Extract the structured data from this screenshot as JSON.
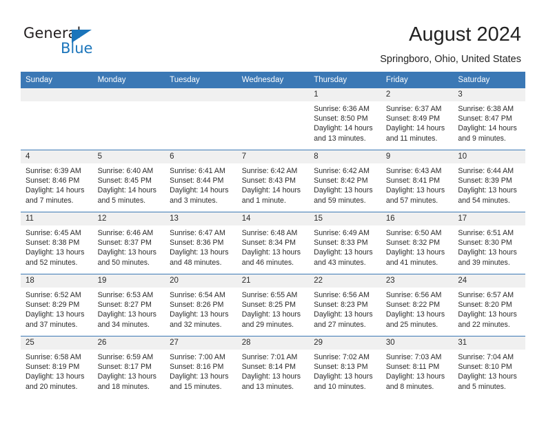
{
  "brand": {
    "name_part1": "General",
    "name_part2": "Blue",
    "accent_color": "#1b75bb"
  },
  "header": {
    "title": "August 2024",
    "location": "Springboro, Ohio, United States"
  },
  "calendar": {
    "header_bg": "#3b78b5",
    "daynum_bg": "#f0f0f0",
    "weekdays": [
      "Sunday",
      "Monday",
      "Tuesday",
      "Wednesday",
      "Thursday",
      "Friday",
      "Saturday"
    ],
    "weeks": [
      [
        {
          "day": "",
          "blank": true,
          "sunrise": "",
          "sunset": "",
          "daylight_line1": "",
          "daylight_line2": ""
        },
        {
          "day": "",
          "blank": true,
          "sunrise": "",
          "sunset": "",
          "daylight_line1": "",
          "daylight_line2": ""
        },
        {
          "day": "",
          "blank": true,
          "sunrise": "",
          "sunset": "",
          "daylight_line1": "",
          "daylight_line2": ""
        },
        {
          "day": "",
          "blank": true,
          "sunrise": "",
          "sunset": "",
          "daylight_line1": "",
          "daylight_line2": ""
        },
        {
          "day": "1",
          "blank": false,
          "sunrise": "Sunrise: 6:36 AM",
          "sunset": "Sunset: 8:50 PM",
          "daylight_line1": "Daylight: 14 hours",
          "daylight_line2": "and 13 minutes."
        },
        {
          "day": "2",
          "blank": false,
          "sunrise": "Sunrise: 6:37 AM",
          "sunset": "Sunset: 8:49 PM",
          "daylight_line1": "Daylight: 14 hours",
          "daylight_line2": "and 11 minutes."
        },
        {
          "day": "3",
          "blank": false,
          "sunrise": "Sunrise: 6:38 AM",
          "sunset": "Sunset: 8:47 PM",
          "daylight_line1": "Daylight: 14 hours",
          "daylight_line2": "and 9 minutes."
        }
      ],
      [
        {
          "day": "4",
          "blank": false,
          "sunrise": "Sunrise: 6:39 AM",
          "sunset": "Sunset: 8:46 PM",
          "daylight_line1": "Daylight: 14 hours",
          "daylight_line2": "and 7 minutes."
        },
        {
          "day": "5",
          "blank": false,
          "sunrise": "Sunrise: 6:40 AM",
          "sunset": "Sunset: 8:45 PM",
          "daylight_line1": "Daylight: 14 hours",
          "daylight_line2": "and 5 minutes."
        },
        {
          "day": "6",
          "blank": false,
          "sunrise": "Sunrise: 6:41 AM",
          "sunset": "Sunset: 8:44 PM",
          "daylight_line1": "Daylight: 14 hours",
          "daylight_line2": "and 3 minutes."
        },
        {
          "day": "7",
          "blank": false,
          "sunrise": "Sunrise: 6:42 AM",
          "sunset": "Sunset: 8:43 PM",
          "daylight_line1": "Daylight: 14 hours",
          "daylight_line2": "and 1 minute."
        },
        {
          "day": "8",
          "blank": false,
          "sunrise": "Sunrise: 6:42 AM",
          "sunset": "Sunset: 8:42 PM",
          "daylight_line1": "Daylight: 13 hours",
          "daylight_line2": "and 59 minutes."
        },
        {
          "day": "9",
          "blank": false,
          "sunrise": "Sunrise: 6:43 AM",
          "sunset": "Sunset: 8:41 PM",
          "daylight_line1": "Daylight: 13 hours",
          "daylight_line2": "and 57 minutes."
        },
        {
          "day": "10",
          "blank": false,
          "sunrise": "Sunrise: 6:44 AM",
          "sunset": "Sunset: 8:39 PM",
          "daylight_line1": "Daylight: 13 hours",
          "daylight_line2": "and 54 minutes."
        }
      ],
      [
        {
          "day": "11",
          "blank": false,
          "sunrise": "Sunrise: 6:45 AM",
          "sunset": "Sunset: 8:38 PM",
          "daylight_line1": "Daylight: 13 hours",
          "daylight_line2": "and 52 minutes."
        },
        {
          "day": "12",
          "blank": false,
          "sunrise": "Sunrise: 6:46 AM",
          "sunset": "Sunset: 8:37 PM",
          "daylight_line1": "Daylight: 13 hours",
          "daylight_line2": "and 50 minutes."
        },
        {
          "day": "13",
          "blank": false,
          "sunrise": "Sunrise: 6:47 AM",
          "sunset": "Sunset: 8:36 PM",
          "daylight_line1": "Daylight: 13 hours",
          "daylight_line2": "and 48 minutes."
        },
        {
          "day": "14",
          "blank": false,
          "sunrise": "Sunrise: 6:48 AM",
          "sunset": "Sunset: 8:34 PM",
          "daylight_line1": "Daylight: 13 hours",
          "daylight_line2": "and 46 minutes."
        },
        {
          "day": "15",
          "blank": false,
          "sunrise": "Sunrise: 6:49 AM",
          "sunset": "Sunset: 8:33 PM",
          "daylight_line1": "Daylight: 13 hours",
          "daylight_line2": "and 43 minutes."
        },
        {
          "day": "16",
          "blank": false,
          "sunrise": "Sunrise: 6:50 AM",
          "sunset": "Sunset: 8:32 PM",
          "daylight_line1": "Daylight: 13 hours",
          "daylight_line2": "and 41 minutes."
        },
        {
          "day": "17",
          "blank": false,
          "sunrise": "Sunrise: 6:51 AM",
          "sunset": "Sunset: 8:30 PM",
          "daylight_line1": "Daylight: 13 hours",
          "daylight_line2": "and 39 minutes."
        }
      ],
      [
        {
          "day": "18",
          "blank": false,
          "sunrise": "Sunrise: 6:52 AM",
          "sunset": "Sunset: 8:29 PM",
          "daylight_line1": "Daylight: 13 hours",
          "daylight_line2": "and 37 minutes."
        },
        {
          "day": "19",
          "blank": false,
          "sunrise": "Sunrise: 6:53 AM",
          "sunset": "Sunset: 8:27 PM",
          "daylight_line1": "Daylight: 13 hours",
          "daylight_line2": "and 34 minutes."
        },
        {
          "day": "20",
          "blank": false,
          "sunrise": "Sunrise: 6:54 AM",
          "sunset": "Sunset: 8:26 PM",
          "daylight_line1": "Daylight: 13 hours",
          "daylight_line2": "and 32 minutes."
        },
        {
          "day": "21",
          "blank": false,
          "sunrise": "Sunrise: 6:55 AM",
          "sunset": "Sunset: 8:25 PM",
          "daylight_line1": "Daylight: 13 hours",
          "daylight_line2": "and 29 minutes."
        },
        {
          "day": "22",
          "blank": false,
          "sunrise": "Sunrise: 6:56 AM",
          "sunset": "Sunset: 8:23 PM",
          "daylight_line1": "Daylight: 13 hours",
          "daylight_line2": "and 27 minutes."
        },
        {
          "day": "23",
          "blank": false,
          "sunrise": "Sunrise: 6:56 AM",
          "sunset": "Sunset: 8:22 PM",
          "daylight_line1": "Daylight: 13 hours",
          "daylight_line2": "and 25 minutes."
        },
        {
          "day": "24",
          "blank": false,
          "sunrise": "Sunrise: 6:57 AM",
          "sunset": "Sunset: 8:20 PM",
          "daylight_line1": "Daylight: 13 hours",
          "daylight_line2": "and 22 minutes."
        }
      ],
      [
        {
          "day": "25",
          "blank": false,
          "sunrise": "Sunrise: 6:58 AM",
          "sunset": "Sunset: 8:19 PM",
          "daylight_line1": "Daylight: 13 hours",
          "daylight_line2": "and 20 minutes."
        },
        {
          "day": "26",
          "blank": false,
          "sunrise": "Sunrise: 6:59 AM",
          "sunset": "Sunset: 8:17 PM",
          "daylight_line1": "Daylight: 13 hours",
          "daylight_line2": "and 18 minutes."
        },
        {
          "day": "27",
          "blank": false,
          "sunrise": "Sunrise: 7:00 AM",
          "sunset": "Sunset: 8:16 PM",
          "daylight_line1": "Daylight: 13 hours",
          "daylight_line2": "and 15 minutes."
        },
        {
          "day": "28",
          "blank": false,
          "sunrise": "Sunrise: 7:01 AM",
          "sunset": "Sunset: 8:14 PM",
          "daylight_line1": "Daylight: 13 hours",
          "daylight_line2": "and 13 minutes."
        },
        {
          "day": "29",
          "blank": false,
          "sunrise": "Sunrise: 7:02 AM",
          "sunset": "Sunset: 8:13 PM",
          "daylight_line1": "Daylight: 13 hours",
          "daylight_line2": "and 10 minutes."
        },
        {
          "day": "30",
          "blank": false,
          "sunrise": "Sunrise: 7:03 AM",
          "sunset": "Sunset: 8:11 PM",
          "daylight_line1": "Daylight: 13 hours",
          "daylight_line2": "and 8 minutes."
        },
        {
          "day": "31",
          "blank": false,
          "sunrise": "Sunrise: 7:04 AM",
          "sunset": "Sunset: 8:10 PM",
          "daylight_line1": "Daylight: 13 hours",
          "daylight_line2": "and 5 minutes."
        }
      ]
    ]
  }
}
